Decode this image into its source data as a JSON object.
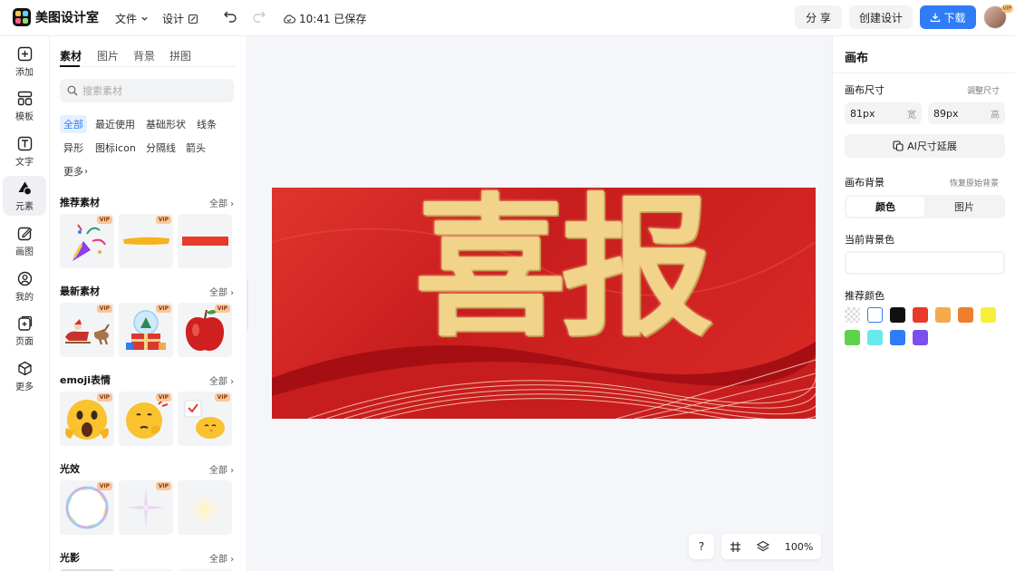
{
  "app": {
    "name": "美图设计室"
  },
  "topbar": {
    "file_label": "文件",
    "design_label": "设计",
    "save_status": "10:41 已保存",
    "share_label": "分 享",
    "create_label": "创建设计",
    "download_label": "下载",
    "avatar_badge": "VIP"
  },
  "nav": {
    "items": [
      {
        "label": "添加",
        "icon": "plus-square-icon"
      },
      {
        "label": "模板",
        "icon": "layout-icon"
      },
      {
        "label": "文字",
        "icon": "text-icon"
      },
      {
        "label": "元素",
        "icon": "shapes-icon"
      },
      {
        "label": "画图",
        "icon": "pencil-icon"
      },
      {
        "label": "我的",
        "icon": "user-icon"
      },
      {
        "label": "页面",
        "icon": "page-add-icon"
      },
      {
        "label": "更多",
        "icon": "cube-icon"
      }
    ]
  },
  "panel": {
    "tabs": [
      "素材",
      "图片",
      "背景",
      "拼图"
    ],
    "search_placeholder": "搜索素材",
    "chips": [
      "全部",
      "最近使用",
      "基础形状",
      "线条",
      "异形",
      "图标icon",
      "分隔线",
      "箭头",
      "更多"
    ],
    "all_label": "全部",
    "vip_badge": "VIP",
    "sections": [
      {
        "title": "推荐素材",
        "items": [
          "party-popper",
          "yellow-brush-stroke",
          "red-brush-stroke"
        ]
      },
      {
        "title": "最新素材",
        "items": [
          "santa-sleigh",
          "snow-globe-gift",
          "red-apple"
        ]
      },
      {
        "title": "emoji表情",
        "items": [
          "scared-face-emoji",
          "thinking-face-emoji",
          "chick-emoji"
        ]
      },
      {
        "title": "光效",
        "items": [
          "bubble-ring",
          "sparkle-star",
          "soft-glow"
        ]
      },
      {
        "title": "光影",
        "items": []
      }
    ]
  },
  "canvas": {
    "text": "喜报",
    "zoom": "100%",
    "help_label": "?",
    "colors": {
      "bg_start": "#e0352e",
      "bg_end": "#c81d1e",
      "text": "#f1d48a"
    }
  },
  "right": {
    "title": "画布",
    "size_label": "画布尺寸",
    "resize_label": "调整尺寸",
    "width": {
      "value": "81px",
      "unit": "宽"
    },
    "height": {
      "value": "89px",
      "unit": "高"
    },
    "ai_label": "AI尺寸延展",
    "bg_label": "画布背景",
    "restore_label": "恢复原始背景",
    "seg": [
      "颜色",
      "图片"
    ],
    "current_label": "当前背景色",
    "recommend_label": "推荐颜色",
    "swatches": [
      "transparent",
      "#ffffff",
      "#111111",
      "#e8392b",
      "#f5a94a",
      "#ef7f2d",
      "#f7ef3b",
      "#5fd14c",
      "#6ae9ec",
      "#2f7cf6",
      "#7b4ff0"
    ]
  }
}
